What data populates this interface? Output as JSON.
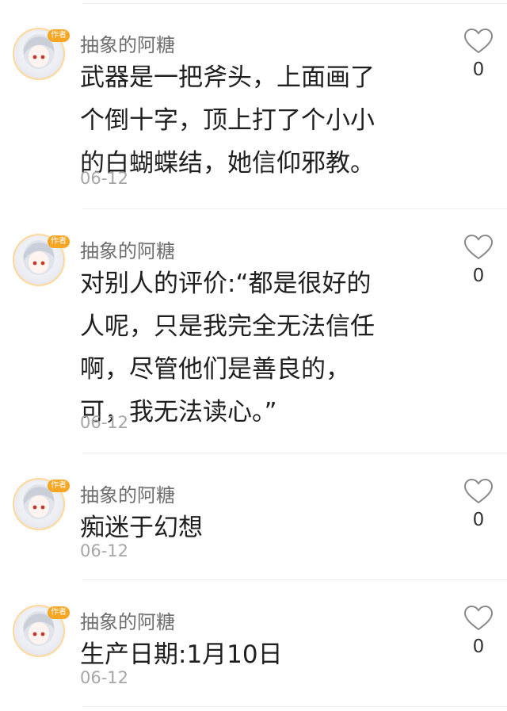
{
  "comments": [
    {
      "username": "抽象的阿糖",
      "badge": "作者",
      "lines": [
        "武器是一把斧头，上面画了",
        "个倒十字，顶上打了个小小",
        "的白蝴蝶结，她信仰邪教。"
      ],
      "date": "06-12",
      "likes": "0"
    },
    {
      "username": "抽象的阿糖",
      "badge": "作者",
      "lines": [
        "对别人的评价:“都是很好的",
        "人呢，只是我完全无法信任",
        "啊，尽管他们是善良的，",
        "可，我无法读心。”"
      ],
      "date": "06-12",
      "likes": "0"
    },
    {
      "username": "抽象的阿糖",
      "badge": "作者",
      "lines": [
        "痴迷于幻想"
      ],
      "date": "06-12",
      "likes": "0"
    },
    {
      "username": "抽象的阿糖",
      "badge": "作者",
      "lines": [
        "生产日期:1月10日"
      ],
      "date": "06-12",
      "likes": "0"
    }
  ],
  "icons": {
    "like": "heart-outline-icon",
    "avatar": "anime-girl-avatar"
  },
  "colors": {
    "badge": "#f6a623",
    "username": "#6e6e6e",
    "date": "#a6a6a6",
    "divider": "#eeeeee"
  }
}
